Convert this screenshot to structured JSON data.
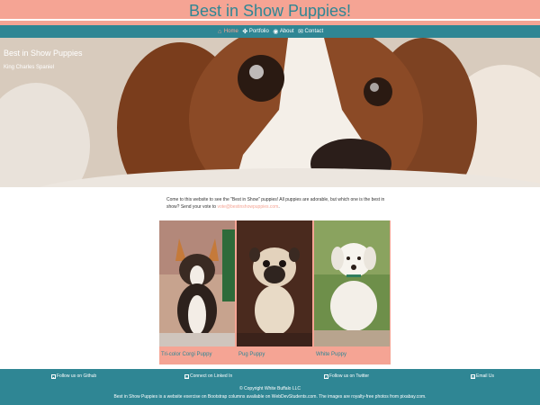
{
  "header": {
    "title": "Best in Show Puppies!"
  },
  "nav": {
    "items": [
      {
        "label": "Home",
        "icon": "home-icon",
        "active": true
      },
      {
        "label": "Portfolio",
        "icon": "paw-icon",
        "active": false
      },
      {
        "label": "About",
        "icon": "user-icon",
        "active": false
      },
      {
        "label": "Contact",
        "icon": "envelope-icon",
        "active": false
      }
    ]
  },
  "hero": {
    "title": "Best in Show Puppies",
    "subtitle": "King Charles Spaniel"
  },
  "intro": {
    "text": "Come to this website to see the \"Best in Show\" puppies! All puppies are adorable, but which one is the best in show? Send your vote to",
    "email": "vote@bestinshowpuppies.com",
    "end": "."
  },
  "gallery": {
    "cards": [
      {
        "caption": "Tri-color Corgi Puppy"
      },
      {
        "caption": "Pug Puppy"
      },
      {
        "caption": "White Puppy"
      }
    ]
  },
  "footer": {
    "links": [
      {
        "label": "Follow us on Github",
        "icon": "github-icon"
      },
      {
        "label": "Connect on Linked In",
        "icon": "linkedin-icon"
      },
      {
        "label": "Follow us on Twitter",
        "icon": "twitter-icon"
      },
      {
        "label": "Email Us",
        "icon": "email-icon"
      }
    ],
    "copyright": "© Copyright White Buffalo LLC",
    "note": "Best in Show Puppies is a website exercise on Bootstrap columns available on WebDevStudents.com. The images are royalty-free photos from pixabay.com."
  },
  "colors": {
    "brand_salmon": "#f5a494",
    "brand_teal": "#2f8694"
  }
}
